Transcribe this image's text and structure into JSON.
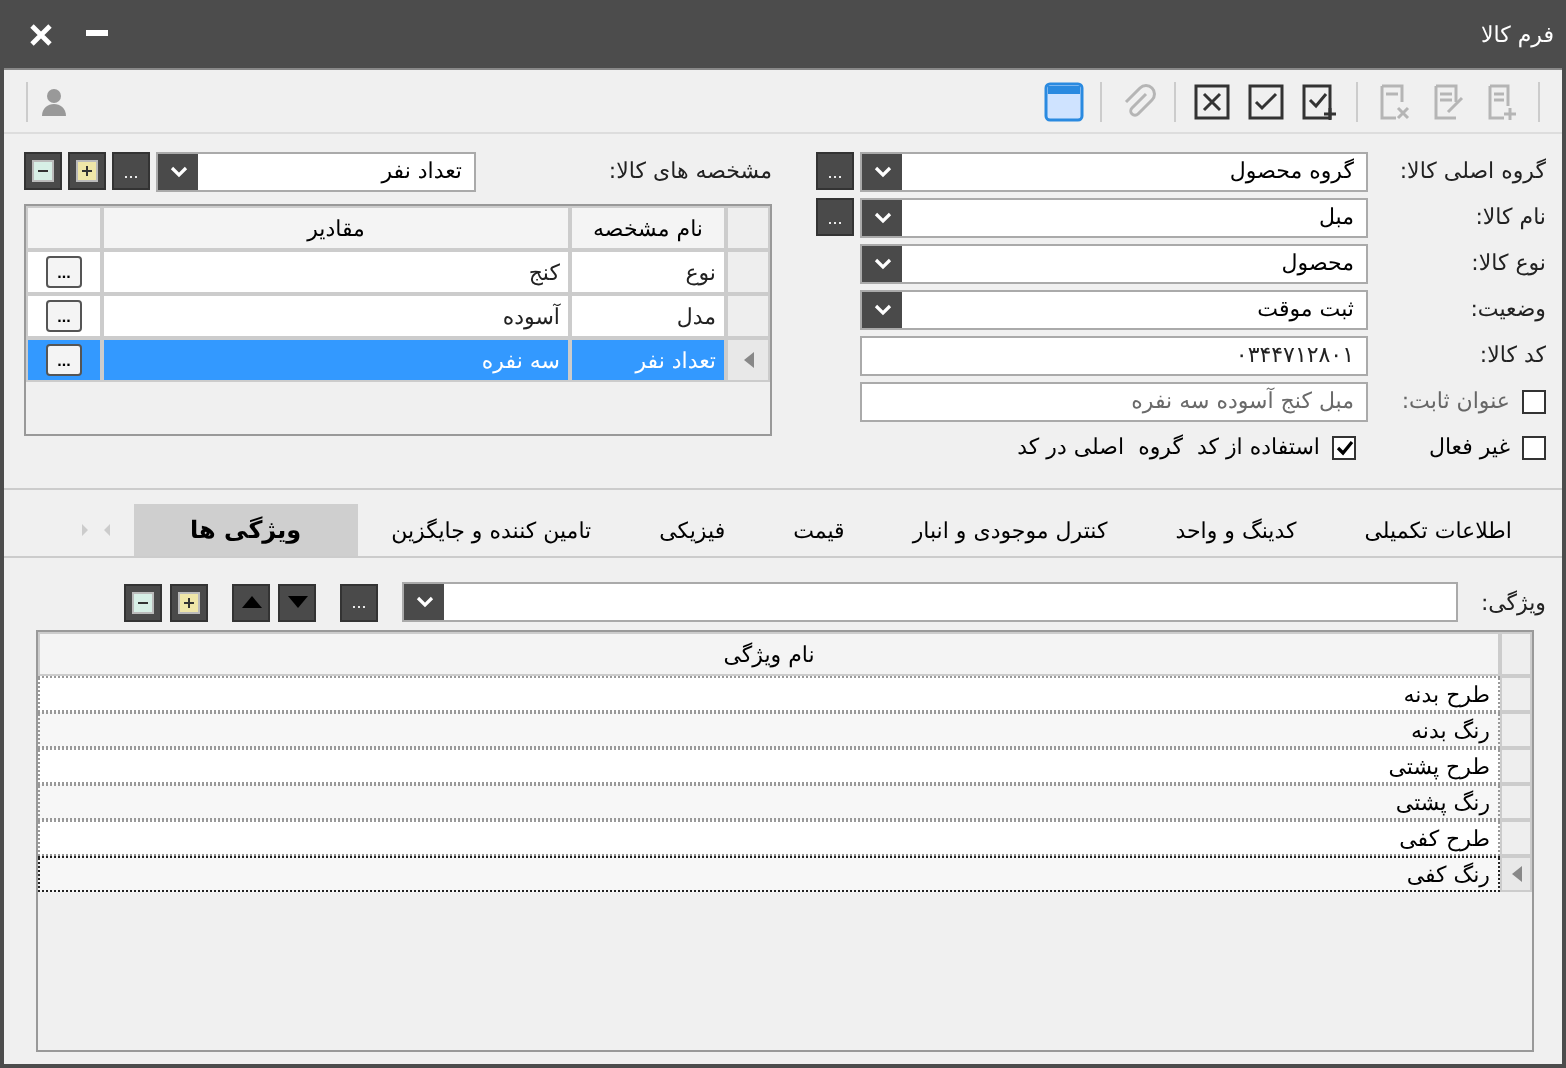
{
  "window": {
    "title": "فرم کالا"
  },
  "toolbar": [
    {
      "kind": "new",
      "disabled": true
    },
    {
      "kind": "edit",
      "disabled": true
    },
    {
      "kind": "delete",
      "disabled": true
    },
    {
      "kind": "save-new",
      "disabled": false
    },
    {
      "kind": "confirm",
      "disabled": false
    },
    {
      "kind": "cancel",
      "disabled": false
    },
    {
      "kind": "attach",
      "disabled": true
    },
    {
      "kind": "calendar",
      "disabled": false
    }
  ],
  "fields": [
    {
      "kind": "combo",
      "label": "گروه اصلی کالا:",
      "value": "گروه محصول",
      "more": "..."
    },
    {
      "kind": "combo",
      "label": "نام کالا:",
      "value": "مبل",
      "more": "..."
    },
    {
      "kind": "combo",
      "label": "نوع کالا:",
      "value": "محصول"
    },
    {
      "kind": "combo",
      "label": "وضعیت:",
      "value": "ثبت موقت"
    },
    {
      "kind": "text",
      "label": "کد کالا:",
      "value": "۰۳۴۴۷۱۲۸۰۱"
    },
    {
      "kind": "check-text",
      "label": "عنوان ثابت:",
      "checked": false,
      "value": "مبل کنج آسوده سه نفره",
      "disabled": true
    }
  ],
  "inactive": {
    "label": "غیر فعال",
    "checked": false
  },
  "use_group_code": {
    "label": "استفاده از کد  گروه  اصلی در کد",
    "checked": true
  },
  "specs": {
    "label": "مشخصه های کالا:",
    "value": "تعداد نفر",
    "more": "...",
    "columns": [
      "نام مشخصه",
      "مقادیر"
    ],
    "rows": [
      {
        "name": "نوع",
        "value": "کنج",
        "button": "...",
        "selected": false
      },
      {
        "name": "مدل",
        "value": "آسوده",
        "button": "...",
        "selected": false
      },
      {
        "name": "تعداد نفر",
        "value": "سه نفره",
        "button": "...",
        "selected": true
      }
    ]
  },
  "tabs": [
    {
      "label": "اطلاعات تکمیلی",
      "selected": false
    },
    {
      "label": "کدینگ و واحد",
      "selected": false
    },
    {
      "label": "کنترل موجودی و انبار",
      "selected": false
    },
    {
      "label": "قیمت",
      "selected": false
    },
    {
      "label": "فیزیکی",
      "selected": false
    },
    {
      "label": "تامین کننده و جایگزین",
      "selected": false
    },
    {
      "label": "ویژگی ها",
      "selected": true
    }
  ],
  "attributes": {
    "label": "ویژگی:",
    "more": "...",
    "column": "نام ویژگی",
    "rows": [
      {
        "name": "طرح بدنه",
        "selected": false
      },
      {
        "name": "رنگ بدنه",
        "selected": false
      },
      {
        "name": "طرح پشتی",
        "selected": false
      },
      {
        "name": "رنگ پشتی",
        "selected": false
      },
      {
        "name": "طرح کفی",
        "selected": false
      },
      {
        "name": "رنگ کفی",
        "selected": true
      }
    ]
  }
}
